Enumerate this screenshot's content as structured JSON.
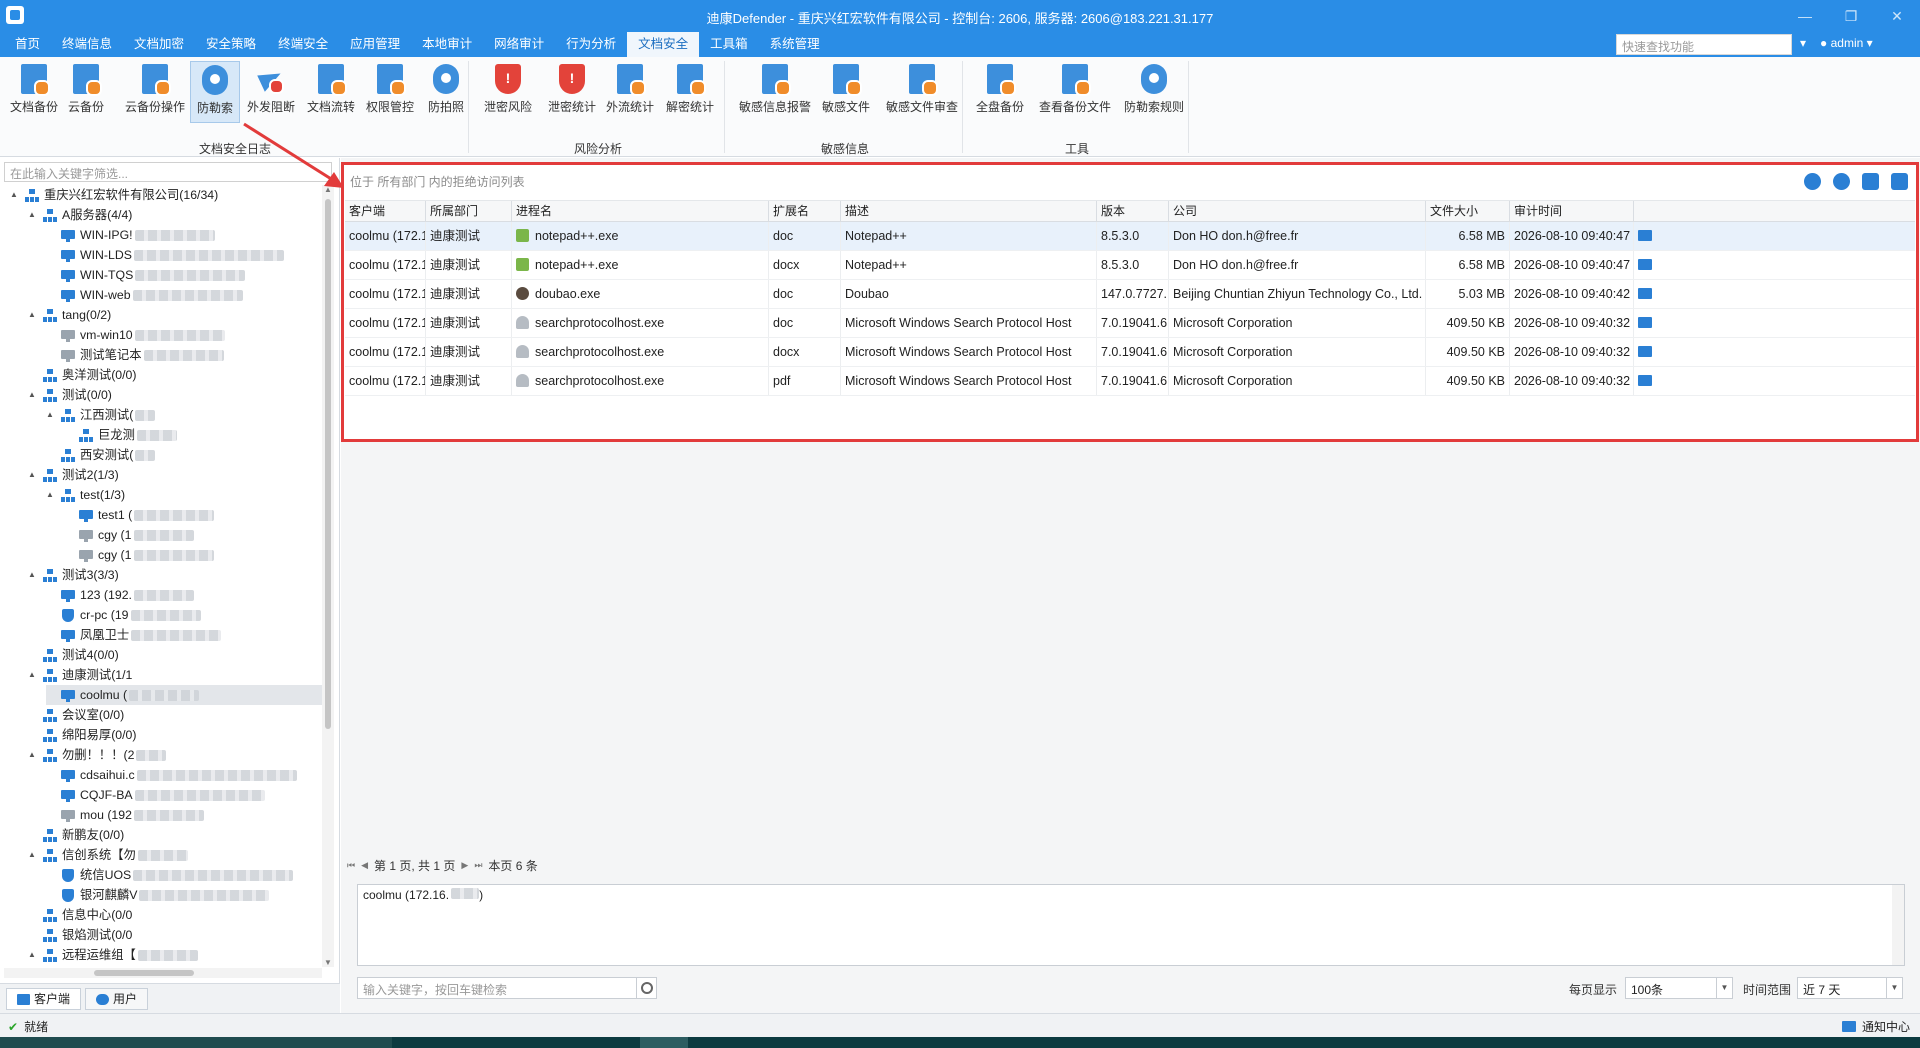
{
  "window": {
    "title": "迪康Defender - 重庆兴红宏软件有限公司 - 控制台: 2606, 服务器: 2606@183.221.31.177",
    "controls": [
      "—",
      "❐",
      "✕"
    ]
  },
  "menu": {
    "items": [
      "首页",
      "终端信息",
      "文档加密",
      "安全策略",
      "终端安全",
      "应用管理",
      "本地审计",
      "网络审计",
      "行为分析",
      "文档安全",
      "工具箱",
      "系统管理"
    ],
    "active_index": 9,
    "quick_search_placeholder": "快速查找功能",
    "user": "admin"
  },
  "ribbon": {
    "groups": [
      {
        "label": "文档安全日志",
        "buttons": [
          "文档备份",
          "云备份",
          "云备份操作",
          "防勒索",
          "外发阻断",
          "文档流转",
          "权限管控",
          "防拍照"
        ]
      },
      {
        "label": "风险分析",
        "buttons": [
          "泄密风险",
          "泄密统计",
          "外流统计",
          "解密统计"
        ]
      },
      {
        "label": "敏感信息",
        "buttons": [
          "敏感信息报警",
          "敏感文件",
          "敏感文件审查"
        ]
      },
      {
        "label": "工具",
        "buttons": [
          "全盘备份",
          "查看备份文件",
          "防勒索规则"
        ]
      }
    ],
    "active_button": "防勒索"
  },
  "left": {
    "filter_placeholder": "在此输入关键字筛选...",
    "tree": [
      {
        "depth": 0,
        "exp": "▲",
        "icon": "org",
        "label": "重庆兴红宏软件有限公司(16/34)"
      },
      {
        "depth": 1,
        "exp": "▲",
        "icon": "org",
        "label": "A服务器(4/4)"
      },
      {
        "depth": 2,
        "exp": "",
        "icon": "pc",
        "label": "WIN-IPG!",
        "blur": 80
      },
      {
        "depth": 2,
        "exp": "",
        "icon": "pc",
        "label": "WIN-LDS",
        "blur": 150
      },
      {
        "depth": 2,
        "exp": "",
        "icon": "pc",
        "label": "WIN-TQS",
        "blur": 110
      },
      {
        "depth": 2,
        "exp": "",
        "icon": "pc",
        "label": "WIN-web",
        "blur": 110
      },
      {
        "depth": 1,
        "exp": "▲",
        "icon": "org",
        "label": "tang(0/2)"
      },
      {
        "depth": 2,
        "exp": "",
        "icon": "pcgray",
        "label": "vm-win10",
        "blur": 90
      },
      {
        "depth": 2,
        "exp": "",
        "icon": "pcgray",
        "label": "测试笔记本",
        "blur": 80
      },
      {
        "depth": 1,
        "exp": "",
        "icon": "org",
        "label": "奥洋测试(0/0)"
      },
      {
        "depth": 1,
        "exp": "▲",
        "icon": "org",
        "label": "测试(0/0)"
      },
      {
        "depth": 2,
        "exp": "▲",
        "icon": "org",
        "label": "江西测试(",
        "blur": 20
      },
      {
        "depth": 3,
        "exp": "",
        "icon": "org",
        "label": "巨龙测",
        "blur": 40
      },
      {
        "depth": 2,
        "exp": "",
        "icon": "org",
        "label": "西安测试(",
        "blur": 20
      },
      {
        "depth": 1,
        "exp": "▲",
        "icon": "org",
        "label": "测试2(1/3)"
      },
      {
        "depth": 2,
        "exp": "▲",
        "icon": "org",
        "label": "test(1/3)"
      },
      {
        "depth": 3,
        "exp": "",
        "icon": "pc",
        "label": "test1 (",
        "blur": 80
      },
      {
        "depth": 3,
        "exp": "",
        "icon": "pcgray",
        "label": "cgy (1",
        "blur": 60
      },
      {
        "depth": 3,
        "exp": "",
        "icon": "pcgray",
        "label": "cgy (1",
        "blur": 80
      },
      {
        "depth": 1,
        "exp": "▲",
        "icon": "org",
        "label": "测试3(3/3)"
      },
      {
        "depth": 2,
        "exp": "",
        "icon": "pc",
        "label": "123 (192.",
        "blur": 60
      },
      {
        "depth": 2,
        "exp": "",
        "icon": "shield",
        "label": "cr-pc (19",
        "blur": 70
      },
      {
        "depth": 2,
        "exp": "",
        "icon": "pc",
        "label": "凤凰卫士",
        "blur": 90
      },
      {
        "depth": 1,
        "exp": "",
        "icon": "org",
        "label": "测试4(0/0)"
      },
      {
        "depth": 1,
        "exp": "▲",
        "icon": "org",
        "label": "迪康测试(1/1",
        "blur": 0
      },
      {
        "depth": 2,
        "exp": "",
        "icon": "pc",
        "label": "coolmu (",
        "blur": 70,
        "selected": true
      },
      {
        "depth": 1,
        "exp": "",
        "icon": "org",
        "label": "会议室(0/0)"
      },
      {
        "depth": 1,
        "exp": "",
        "icon": "org",
        "label": "绵阳易厚(0/0)"
      },
      {
        "depth": 1,
        "exp": "▲",
        "icon": "org",
        "label": "勿删！！！(2",
        "blur": 30
      },
      {
        "depth": 2,
        "exp": "",
        "icon": "pc",
        "label": "cdsaihui.c",
        "blur": 160
      },
      {
        "depth": 2,
        "exp": "",
        "icon": "pc",
        "label": "CQJF-BA",
        "blur": 130
      },
      {
        "depth": 2,
        "exp": "",
        "icon": "pcgray",
        "label": "mou (192",
        "blur": 70
      },
      {
        "depth": 1,
        "exp": "",
        "icon": "org",
        "label": "新鹏友(0/0)"
      },
      {
        "depth": 1,
        "exp": "▲",
        "icon": "org",
        "label": "信创系统【勿",
        "blur": 50
      },
      {
        "depth": 2,
        "exp": "",
        "icon": "shield",
        "label": "统信UOS",
        "blur": 160
      },
      {
        "depth": 2,
        "exp": "",
        "icon": "shield",
        "label": "银河麒麟V",
        "blur": 130
      },
      {
        "depth": 1,
        "exp": "",
        "icon": "org",
        "label": "信息中心(0/0"
      },
      {
        "depth": 1,
        "exp": "",
        "icon": "org",
        "label": "银焰测试(0/0"
      },
      {
        "depth": 1,
        "exp": "▲",
        "icon": "org",
        "label": "远程运维组【",
        "blur": 60
      }
    ],
    "tabs": [
      "客户端",
      "用户"
    ]
  },
  "main": {
    "location": "位于 所有部门 内的拒绝访问列表",
    "columns": [
      "客户端",
      "所属部门",
      "进程名",
      "扩展名",
      "描述",
      "版本",
      "公司",
      "文件大小",
      "审计时间"
    ],
    "rows": [
      {
        "client": "coolmu (172.1...",
        "dept": "迪康测试",
        "icon": "np",
        "process": "notepad++.exe",
        "ext": "doc",
        "desc": "Notepad++",
        "version": "8.5.3.0",
        "company": "Don HO don.h@free.fr",
        "size": "6.58 MB",
        "time": "2026-08-10 09:40:47",
        "selected": true
      },
      {
        "client": "coolmu (172.1...",
        "dept": "迪康测试",
        "icon": "np",
        "process": "notepad++.exe",
        "ext": "docx",
        "desc": "Notepad++",
        "version": "8.5.3.0",
        "company": "Don HO don.h@free.fr",
        "size": "6.58 MB",
        "time": "2026-08-10 09:40:47"
      },
      {
        "client": "coolmu (172.1...",
        "dept": "迪康测试",
        "icon": "db",
        "process": "doubao.exe",
        "ext": "doc",
        "desc": "Doubao",
        "version": "147.0.7727....",
        "company": "Beijing Chuntian Zhiyun Technology Co., Ltd.",
        "size": "5.03 MB",
        "time": "2026-08-10 09:40:42"
      },
      {
        "client": "coolmu (172.1...",
        "dept": "迪康测试",
        "icon": "sp",
        "process": "searchprotocolhost.exe",
        "ext": "doc",
        "desc": "Microsoft Windows Search Protocol Host",
        "version": "7.0.19041.6...",
        "company": "Microsoft Corporation",
        "size": "409.50 KB",
        "time": "2026-08-10 09:40:32"
      },
      {
        "client": "coolmu (172.1...",
        "dept": "迪康测试",
        "icon": "sp",
        "process": "searchprotocolhost.exe",
        "ext": "docx",
        "desc": "Microsoft Windows Search Protocol Host",
        "version": "7.0.19041.6...",
        "company": "Microsoft Corporation",
        "size": "409.50 KB",
        "time": "2026-08-10 09:40:32"
      },
      {
        "client": "coolmu (172.1...",
        "dept": "迪康测试",
        "icon": "sp",
        "process": "searchprotocolhost.exe",
        "ext": "pdf",
        "desc": "Microsoft Windows Search Protocol Host",
        "version": "7.0.19041.6...",
        "company": "Microsoft Corporation",
        "size": "409.50 KB",
        "time": "2026-08-10 09:40:32"
      }
    ],
    "pager": {
      "page_text": "第 1 页, 共 1 页",
      "count_text": "本页 6 条"
    },
    "detail_text": "coolmu (172.16.",
    "search_placeholder": "输入关键字，按回车键检索",
    "per_page_label": "每页显示",
    "per_page_value": "100条",
    "time_range_label": "时间范围",
    "time_range_value": "近 7 天"
  },
  "status": {
    "left": "就绪",
    "right": "通知中心"
  }
}
